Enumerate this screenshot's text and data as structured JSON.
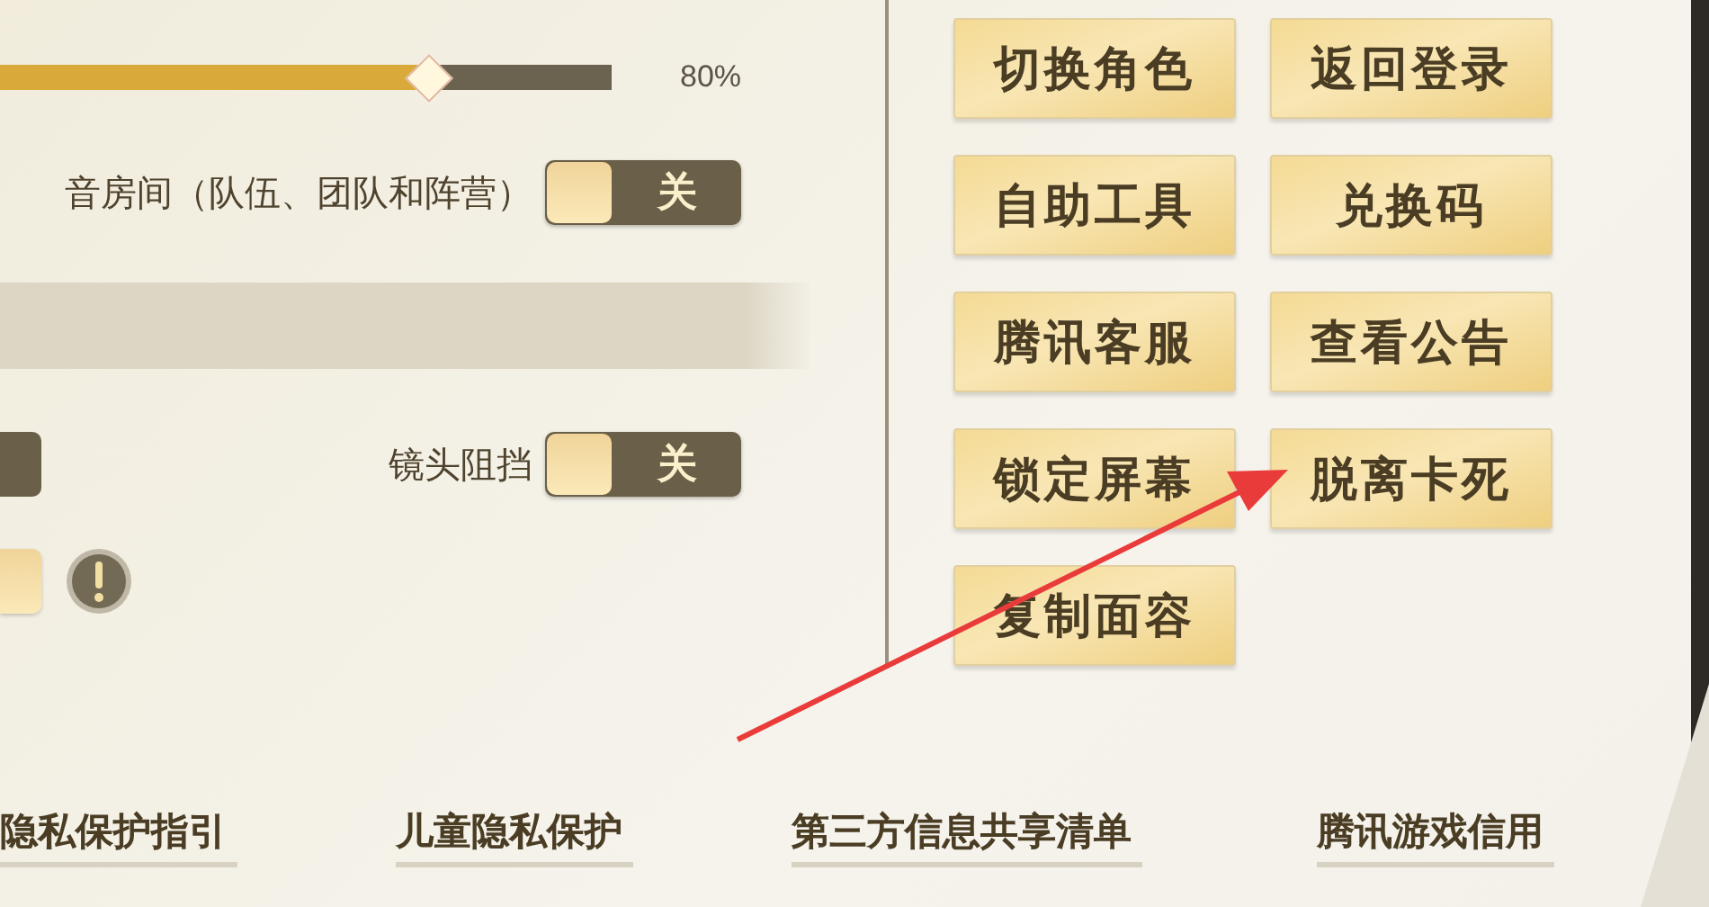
{
  "volume_slider": {
    "level": 0.71,
    "reading": "80%"
  },
  "toggles": [
    {
      "label": "音房间（队伍、团队和阵营）",
      "switch_text": "关",
      "on": false
    },
    {
      "label": "镜头阻挡",
      "switch_text": "关",
      "on": false
    }
  ],
  "partial_toggles": [
    {
      "on": false
    },
    {
      "on": true
    }
  ],
  "buttons": [
    "切换角色",
    "返回登录",
    "自助工具",
    "兑换码",
    "腾讯客服",
    "查看公告",
    "锁定屏幕",
    "脱离卡死",
    "复制面容"
  ],
  "footer_links": [
    "隐私保护指引",
    "儿童隐私保护",
    "第三方信息共享清单",
    "腾讯游戏信用"
  ]
}
